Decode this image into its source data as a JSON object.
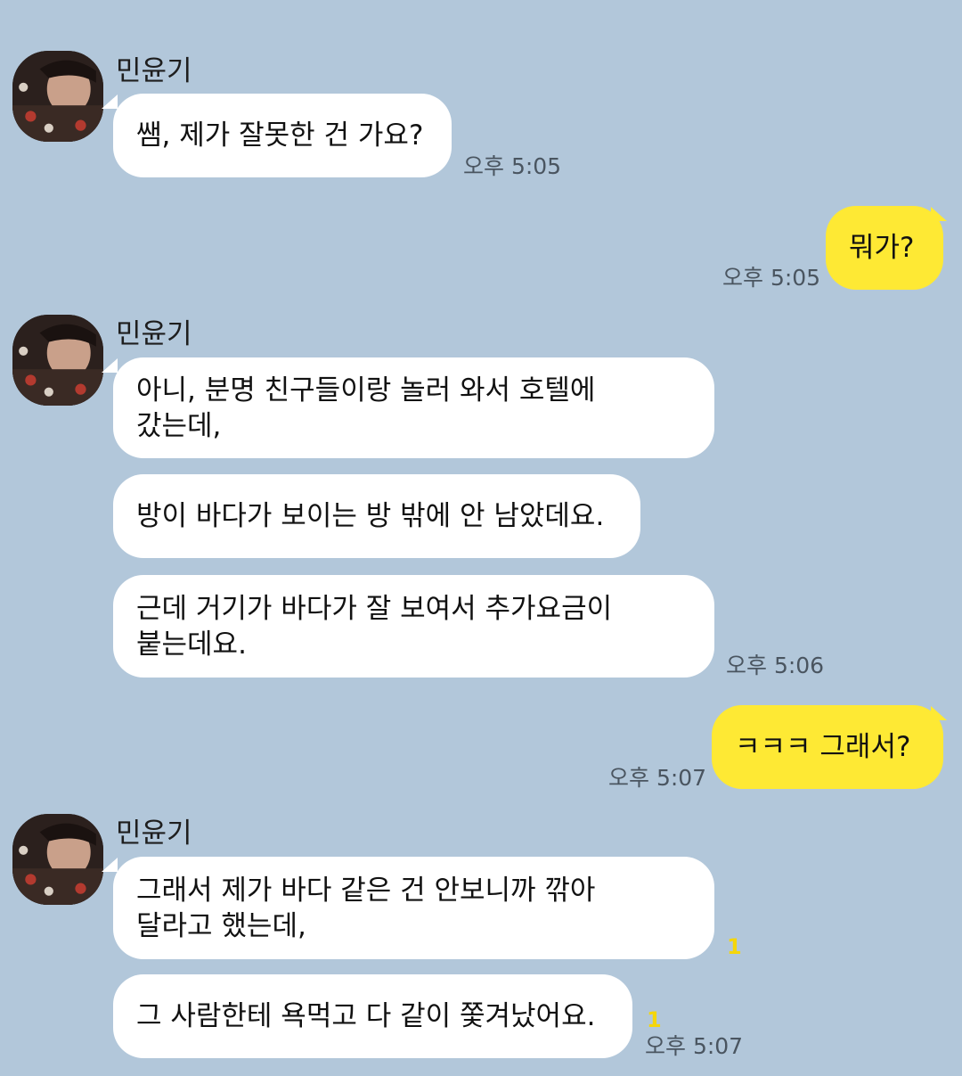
{
  "sender_name": "민윤기",
  "messages": [
    {
      "text": [
        "쌤, 제가 잘못한 건 가요?"
      ],
      "time": "오후 5:05"
    },
    {
      "text": [
        "뭐가?"
      ],
      "time": "오후 5:05"
    },
    {
      "text": [
        "아니, 분명 친구들이랑 놀러 와서 호텔에",
        "갔는데,"
      ]
    },
    {
      "text": [
        "방이 바다가 보이는 방 밖에 안 남았데요."
      ]
    },
    {
      "text": [
        "근데 거기가 바다가 잘 보여서 추가요금이",
        "붙는데요."
      ],
      "time": "오후 5:06"
    },
    {
      "text": [
        "ㅋㅋㅋ 그래서?"
      ],
      "time": "오후 5:07"
    },
    {
      "text": [
        "그래서 제가 바다 같은 건 안보니까 깎아",
        "달라고 했는데,"
      ],
      "unread": "1"
    },
    {
      "text": [
        "그 사람한테 욕먹고 다 같이 쫓겨났어요."
      ],
      "unread": "1",
      "time": "오후 5:07"
    }
  ],
  "colors": {
    "background": "#b2c7da",
    "incoming_bubble": "#ffffff",
    "outgoing_bubble": "#fee934",
    "unread_count": "#f5d60a"
  },
  "icons": {
    "avatar": "profile-photo-avatar"
  }
}
